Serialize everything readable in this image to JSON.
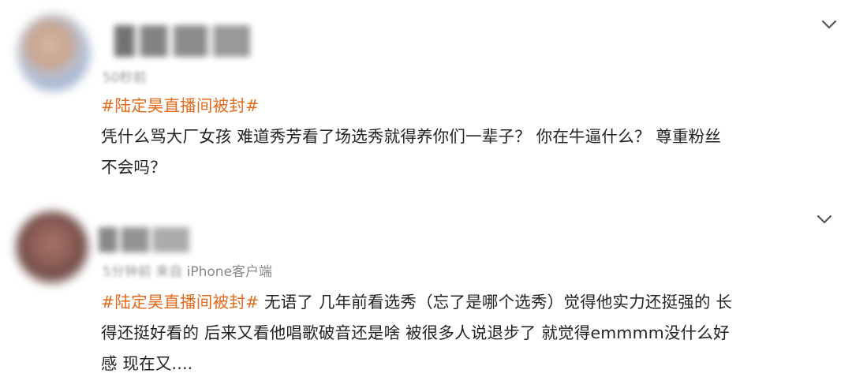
{
  "posts": [
    {
      "meta_time_blurred": "50秒前",
      "meta_source": "",
      "hashtag": "#陆定昊直播间被封#",
      "text_lines": [
        "凭什么骂大厂女孩 难道秀芳看了场选秀就得养你们一辈子？ 你在牛逼什么？ 尊重粉丝",
        "不会吗？"
      ]
    },
    {
      "meta_time_blurred": "5分钟前",
      "meta_source_blurred": "来自",
      "meta_source": "iPhone客户端",
      "hashtag": "#陆定昊直播间被封#",
      "first_line_rest": " 无语了 几年前看选秀（忘了是哪个选秀）觉得他实力还挺强的 长",
      "text_lines": [
        "得还挺好看的 后来又看他唱歌破音还是啥 被很多人说退步了 就觉得emmmm没什么好",
        "感 现在又...."
      ]
    }
  ],
  "colors": {
    "hashtag": "#e36a1a",
    "text": "#222222",
    "meta": "#888888"
  },
  "icons": {
    "expand": "chevron-down-icon"
  }
}
